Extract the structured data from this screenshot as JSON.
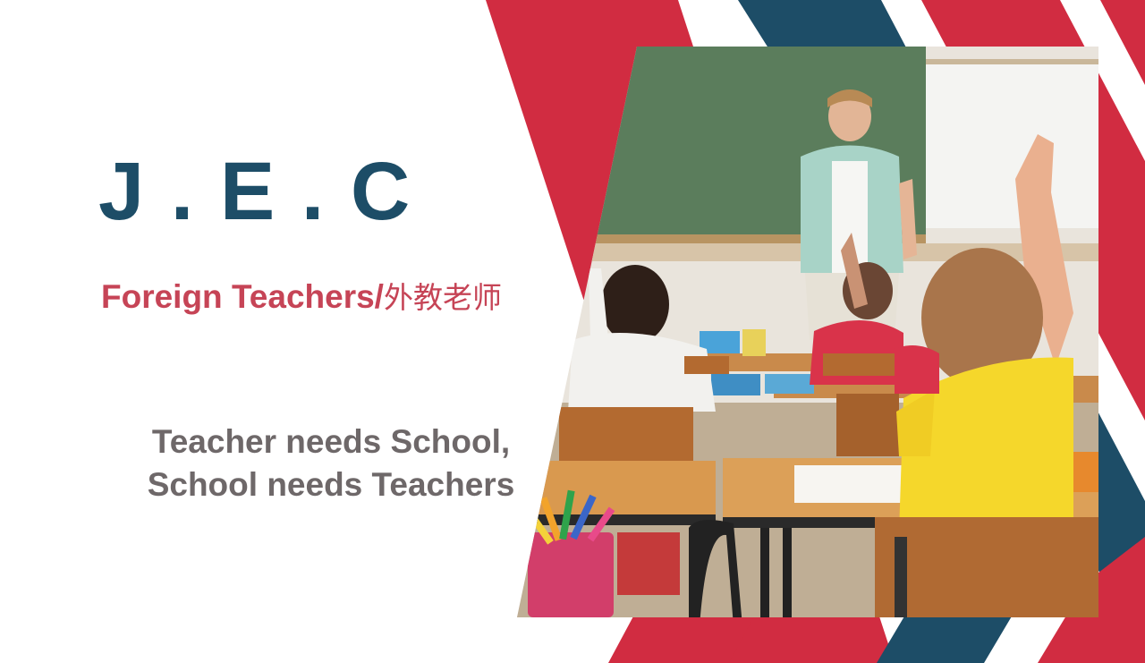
{
  "brand": {
    "name": "J . E . C"
  },
  "subtitle": {
    "en": "Foreign Teachers/",
    "cn": "外教老师"
  },
  "tagline": {
    "line1": "Teacher needs School,",
    "line2": "School needs Teachers"
  },
  "colors": {
    "navy": "#1d4d67",
    "red": "#d12c41",
    "pink_red": "#c64456",
    "gray_text": "#6e6869"
  },
  "photo": {
    "subject": "classroom-photo"
  }
}
